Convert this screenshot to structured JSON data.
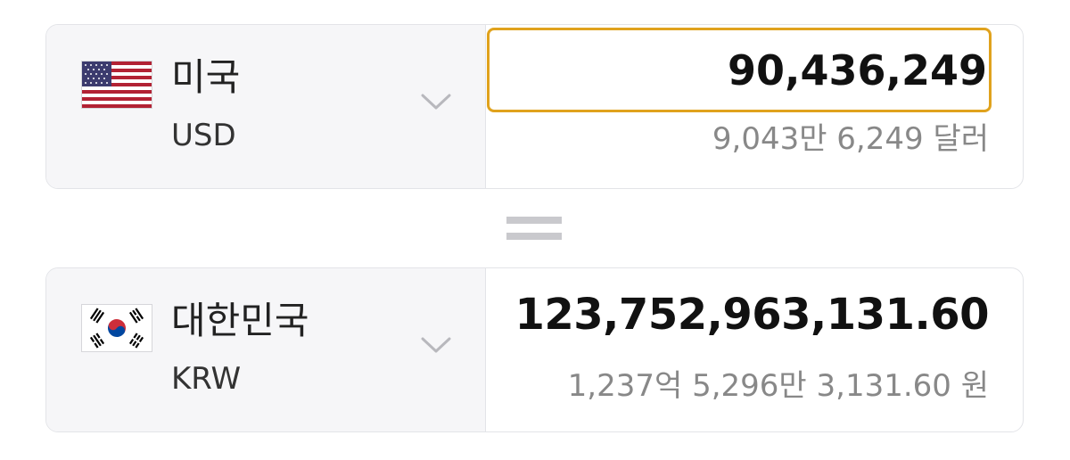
{
  "from": {
    "country": "미국",
    "code": "USD",
    "flag_icon": "us-flag-icon",
    "amount": "90,436,249",
    "amount_words": "9,043만 6,249 달러",
    "input_border_color": "#e0a21d"
  },
  "equals_icon": "equals-icon",
  "to": {
    "country": "대한민국",
    "code": "KRW",
    "flag_icon": "kr-flag-icon",
    "amount": "123,752,963,131.60",
    "amount_words": "1,237억 5,296만 3,131.60 원"
  },
  "colors": {
    "selector_bg": "#f6f6f8",
    "border": "#e3e4e8",
    "accent": "#e0a21d",
    "secondary_text": "#888888"
  }
}
